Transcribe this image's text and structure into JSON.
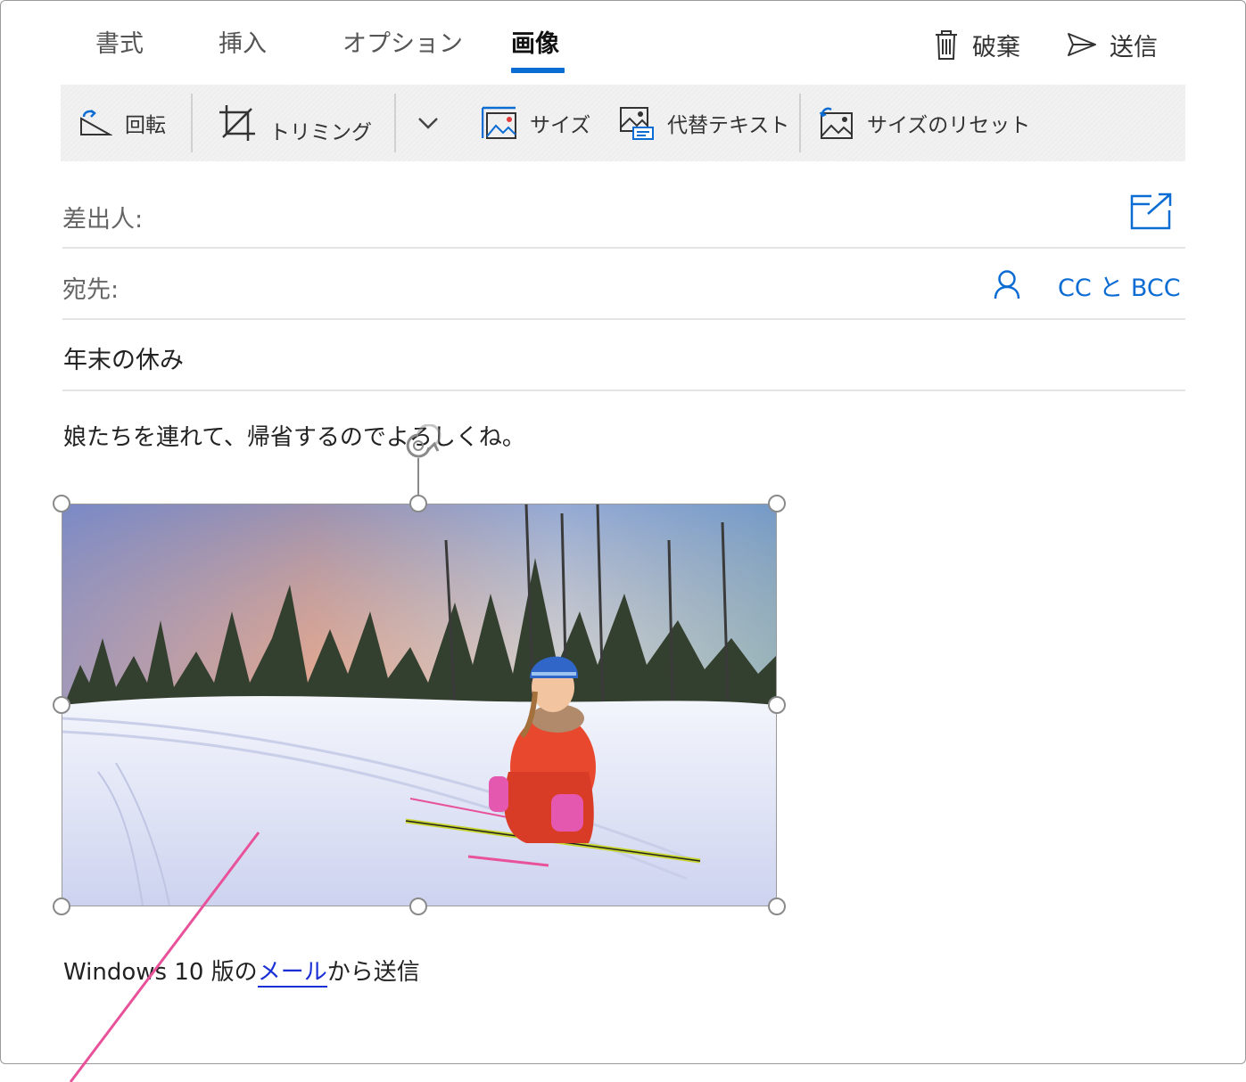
{
  "tabs": [
    "書式",
    "挿入",
    "オプション",
    "画像"
  ],
  "active_tab": "画像",
  "actions": {
    "discard": "破棄",
    "send": "送信"
  },
  "ribbon": {
    "rotate": "回転",
    "crop": "トリミング",
    "size": "サイズ",
    "alt_text": "代替テキスト",
    "reset_size": "サイズのリセット"
  },
  "fields": {
    "from_label": "差出人:",
    "to_label": "宛先:",
    "cc_bcc": "CC と BCC",
    "subject": "年末の休み"
  },
  "body": {
    "message": "娘たちを連れて、帰省するのでよろしくね。",
    "signature_prefix": "Windows 10 版の",
    "signature_link": "メール",
    "signature_suffix": "から送信"
  },
  "colors": {
    "accent": "#0b6cd4",
    "annotation": "#e8529a"
  },
  "icons": [
    "trash-icon",
    "send-icon",
    "rotate-icon",
    "crop-icon",
    "chevron-down-icon",
    "size-icon",
    "alt-text-icon",
    "reset-size-icon",
    "popout-icon",
    "person-icon",
    "rotate-handle-icon"
  ]
}
